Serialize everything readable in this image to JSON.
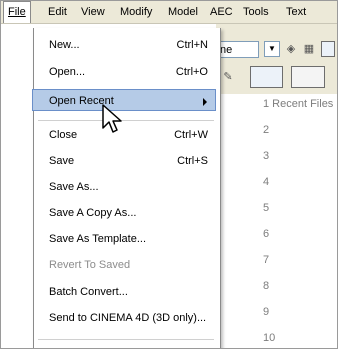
{
  "menubar": {
    "items": [
      {
        "label": "File"
      },
      {
        "label": "Edit"
      },
      {
        "label": "View"
      },
      {
        "label": "Modify"
      },
      {
        "label": "Model"
      },
      {
        "label": "AEC"
      },
      {
        "label": "Tools"
      },
      {
        "label": "Text"
      }
    ]
  },
  "toolbar": {
    "combo_value": "ne"
  },
  "file_menu": {
    "items": [
      {
        "label": "New...",
        "shortcut": "Ctrl+N"
      },
      {
        "label": "Open...",
        "shortcut": "Ctrl+O"
      },
      {
        "label": "Open Recent"
      },
      {
        "label": "Close",
        "shortcut": "Ctrl+W"
      },
      {
        "label": "Save",
        "shortcut": "Ctrl+S"
      },
      {
        "label": "Save As..."
      },
      {
        "label": "Save A Copy As..."
      },
      {
        "label": "Save As Template..."
      },
      {
        "label": "Revert To Saved"
      },
      {
        "label": "Batch Convert..."
      },
      {
        "label": "Send to CINEMA 4D (3D only)..."
      }
    ]
  },
  "recent_files": {
    "items": [
      "1 Recent Files",
      "2",
      "3",
      "4",
      "5",
      "6",
      "7",
      "8",
      "9",
      "10"
    ]
  },
  "colors": {
    "menubar_bg": "#ece9d8",
    "highlight_bg": "#b5cbe7",
    "highlight_border": "#6a8fc9",
    "disabled_text": "#8c8c8c"
  }
}
